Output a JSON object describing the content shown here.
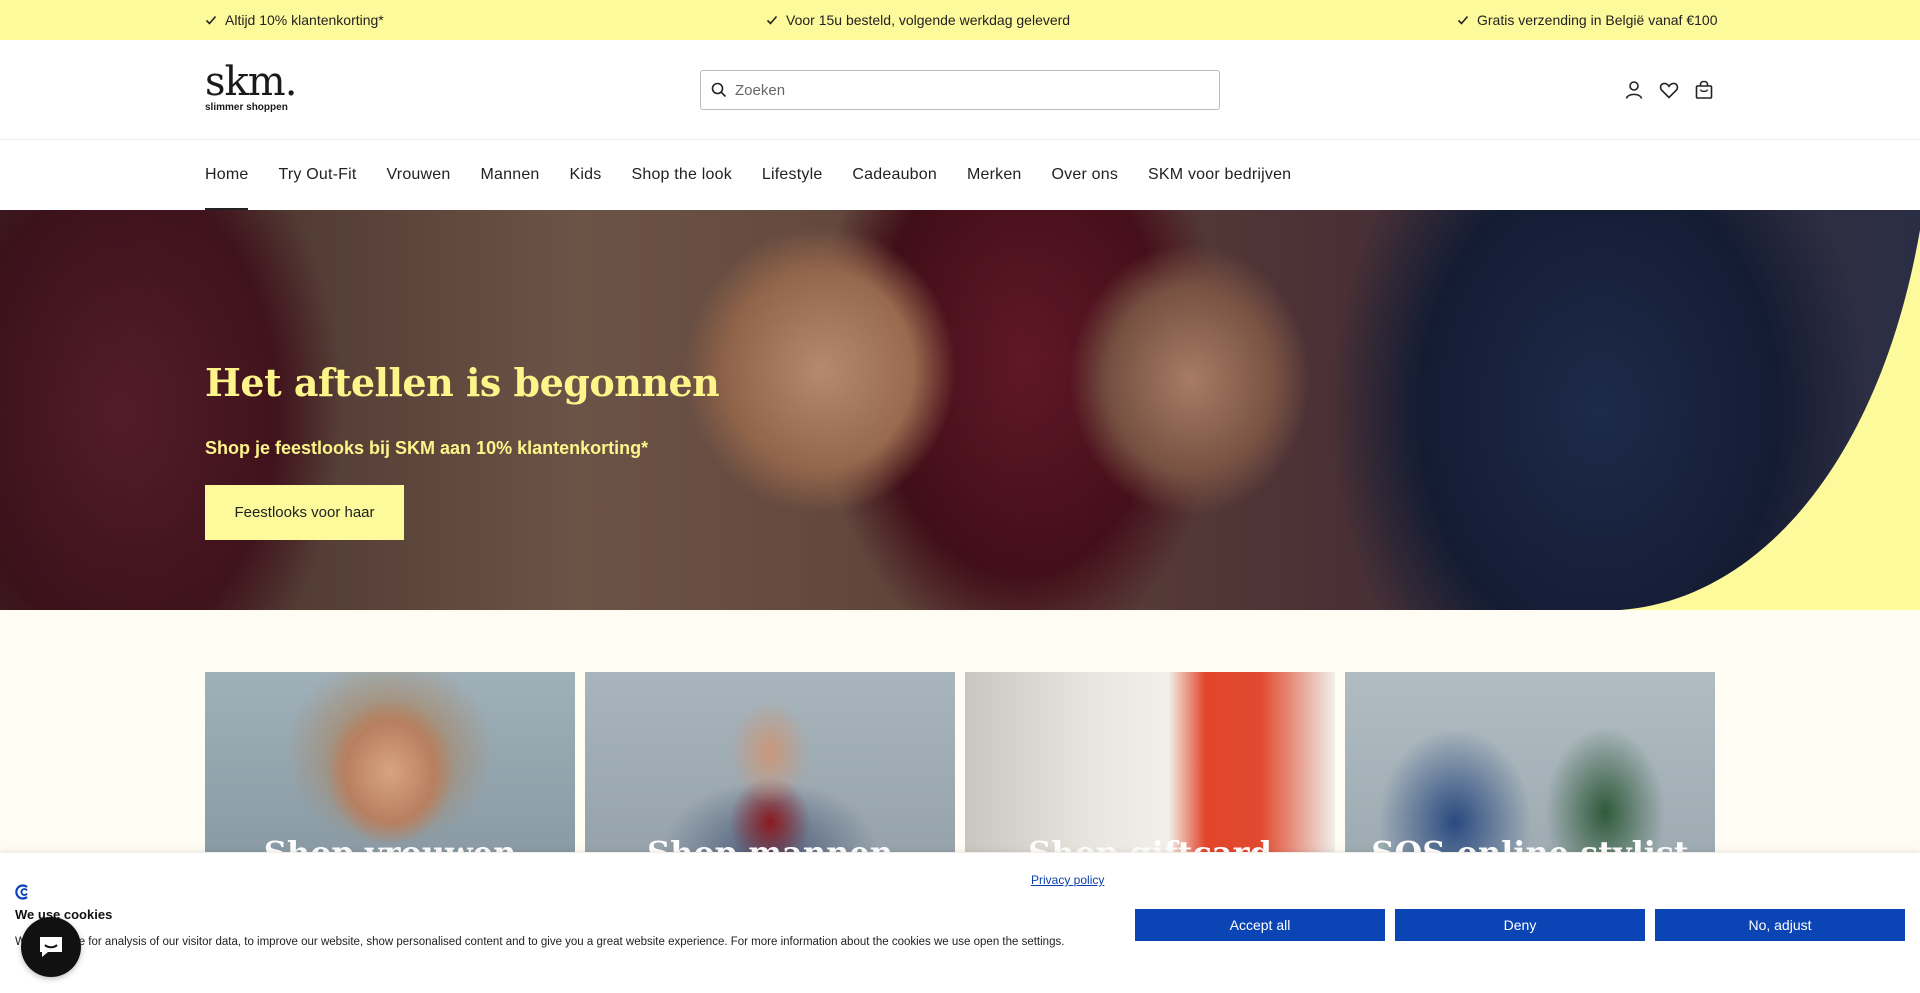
{
  "announcements": [
    "Altijd 10% klantenkorting*",
    "Voor 15u besteld, volgende werkdag geleverd",
    "Gratis verzending in België vanaf €100"
  ],
  "header": {
    "logo_word": "skm.",
    "logo_tagline": "slimmer shoppen",
    "search_placeholder": "Zoeken",
    "icons": [
      "account-icon",
      "wishlist-heart-icon",
      "cart-bag-icon"
    ]
  },
  "nav": {
    "items": [
      "Home",
      "Try Out-Fit",
      "Vrouwen",
      "Mannen",
      "Kids",
      "Shop the look",
      "Lifestyle",
      "Cadeaubon",
      "Merken",
      "Over ons",
      "SKM voor bedrijven"
    ],
    "active": "Home"
  },
  "hero": {
    "title": "Het aftellen is begonnen",
    "subtitle": "Shop je feestlooks bij SKM aan 10% klantenkorting*",
    "cta": "Feestlooks voor haar"
  },
  "tiles": [
    "Shop vrouwen",
    "Shop mannen",
    "Shop giftcard",
    "SOS online stylist Liz"
  ],
  "cookie": {
    "title": "We use cookies",
    "text": "We use these for analysis of our visitor data, to improve our website, show personalised content and to give you a great website experience. For more information about the cookies we use open the settings.",
    "privacy": "Privacy policy",
    "buttons": [
      "Accept all",
      "Deny",
      "No, adjust"
    ]
  },
  "colors": {
    "accent_yellow": "#fdfa9b",
    "hero_text_yellow": "#fdf58a",
    "cookie_blue": "#0b45b5",
    "page_cream": "#fffcf3"
  }
}
